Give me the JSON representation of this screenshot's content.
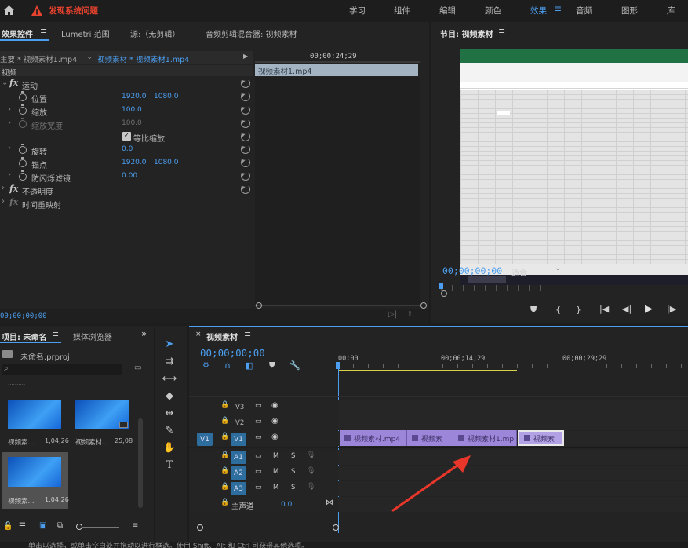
{
  "top_bar": {
    "warning_label": "发现系统问题",
    "workspaces": [
      "学习",
      "组件",
      "编辑",
      "颜色",
      "效果",
      "音频",
      "图形",
      "库"
    ],
    "active_workspace": "效果"
  },
  "effects_panel": {
    "tabs": [
      "效果控件",
      "Lumetri 范围",
      "源:（无剪辑）",
      "音频剪辑混合器: 视频素材"
    ],
    "master_label": "主要 * 视频素材1.mp4",
    "clip_label": "视频素材 * 视频素材1.mp4",
    "timecode": "00;00;24;29",
    "mini_clip": "视频素材1.mp4",
    "section": "视频",
    "motion": "运动",
    "position": {
      "label": "位置",
      "x": "1920.0",
      "y": "1080.0"
    },
    "scale": {
      "label": "缩放",
      "value": "100.0"
    },
    "scale_width": {
      "label": "缩放宽度",
      "value": "100.0"
    },
    "uniform_scale": "等比缩放",
    "rotation": {
      "label": "旋转",
      "value": "0.0"
    },
    "anchor": {
      "label": "锚点",
      "x": "1920.0",
      "y": "1080.0"
    },
    "antiflicker": {
      "label": "防闪烁滤镜",
      "value": "0.00"
    },
    "opacity": "不透明度",
    "time_remap": "时间重映射",
    "bottom_timecode": "00;00;00;00"
  },
  "program_monitor": {
    "title": "节目: 视频素材",
    "timecode": "00;00;00;00",
    "fit": "适合"
  },
  "project_panel": {
    "tabs": [
      "项目: 未命名",
      "媒体浏览器"
    ],
    "file": "未命名.prproj",
    "items": [
      {
        "name": "视频素...",
        "duration": "1;04;26"
      },
      {
        "name": "视频素材...",
        "duration": "25;08"
      },
      {
        "name": "视频素...",
        "duration": "1;04;26"
      }
    ]
  },
  "timeline": {
    "tab": "视频素材",
    "timecode": "00;00;00;00",
    "ruler": [
      "00;00",
      "00;00;14;29",
      "00;00;29;29"
    ],
    "video_tracks": [
      "V3",
      "V2",
      "V1"
    ],
    "audio_tracks": [
      "A1",
      "A2",
      "A3"
    ],
    "source_v": "V1",
    "mix_label": "主声道",
    "mix_value": "0.0",
    "clips": [
      "视频素材.mp4",
      "视频素",
      "视频素材1.mp",
      "视频素"
    ]
  },
  "status_bar": {
    "text": "单击以选择，或单击空白处并拖动以进行框选。使用 Shift、Alt 和 Ctrl 可获得其他选项。"
  },
  "colors": {
    "accent": "#4c9ff0",
    "warning": "#e8432e",
    "clip": "#9c86d9",
    "arrow": "#e8372a"
  }
}
